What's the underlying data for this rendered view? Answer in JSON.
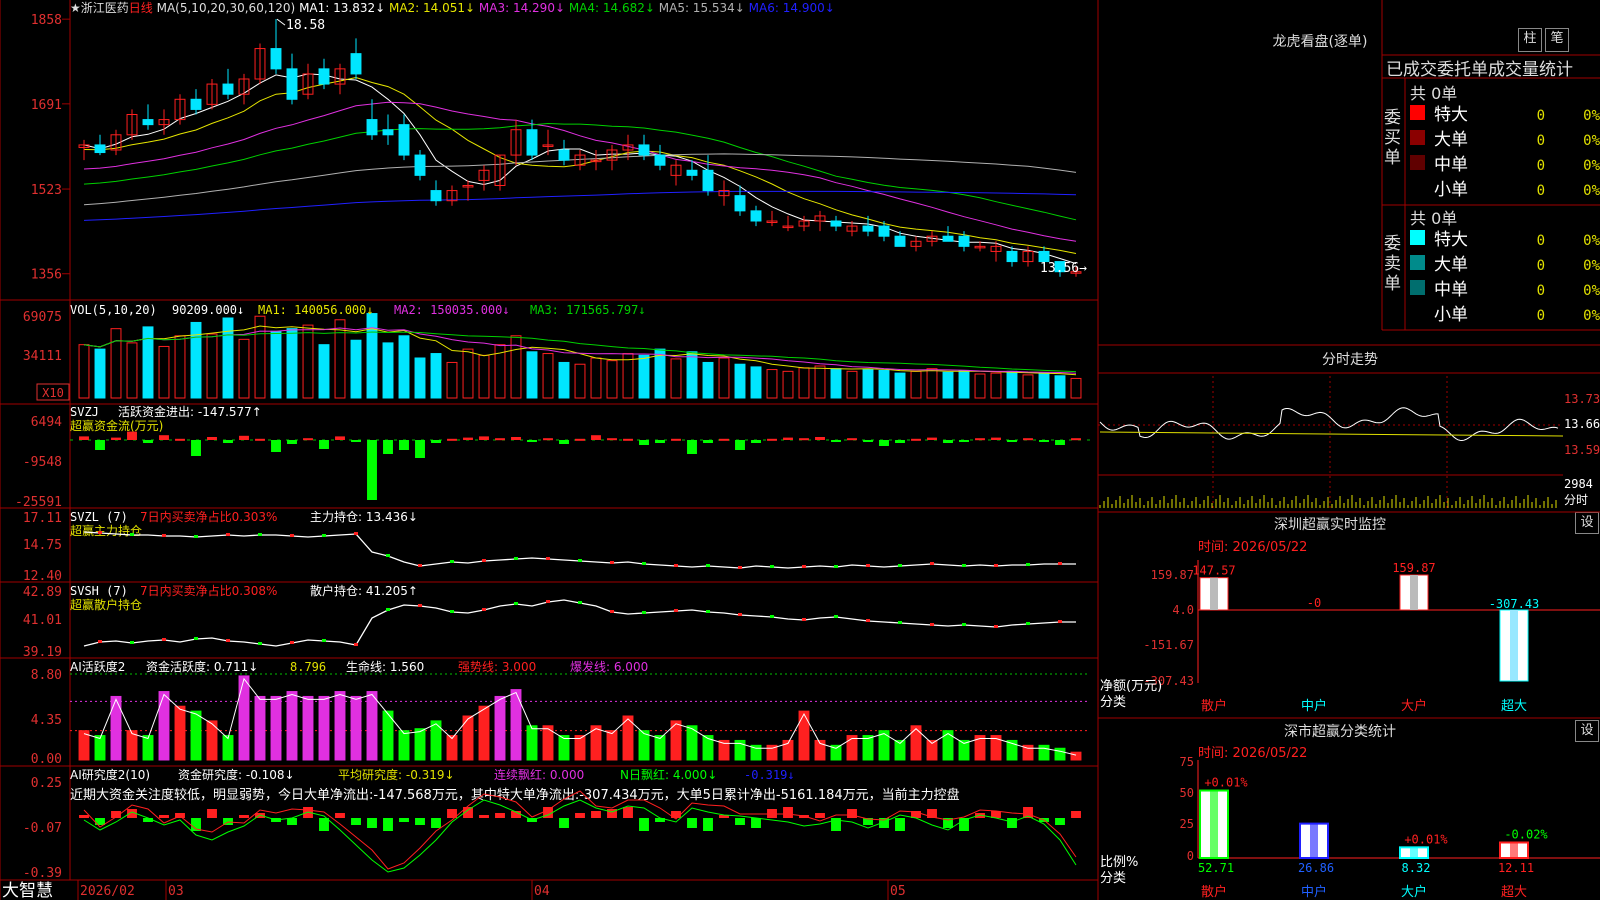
{
  "colors": {
    "up": "#ff2020",
    "down": "#00e6ff",
    "grid": "#a00000",
    "ma5": "#ffffff",
    "ma10": "#e5e500",
    "ma20": "#e030e0",
    "ma30": "#00d000",
    "ma60": "#b0b0b0",
    "ma120": "#2020ff",
    "white": "#ffffff",
    "yellow": "#e0e000",
    "magenta": "#e030e0",
    "green": "#00ff00",
    "axis": "#e03030"
  },
  "main": {
    "stock_name": "★浙江医药",
    "period": "日线",
    "ma_title": "MA(5,10,20,30,60,120)",
    "ma_values": [
      {
        "label": "MA1: 13.832↓",
        "color": "#ffffff"
      },
      {
        "label": "MA2: 14.051↓",
        "color": "#e5e500"
      },
      {
        "label": "MA3: 14.290↓",
        "color": "#e030e0"
      },
      {
        "label": "MA4: 14.682↓",
        "color": "#00d000"
      },
      {
        "label": "MA5: 15.534↓",
        "color": "#b0b0b0"
      },
      {
        "label": "MA6: 14.900↓",
        "color": "#2020ff"
      }
    ],
    "y_ticks": [
      "1858",
      "1691",
      "1523",
      "1356"
    ],
    "high_label": "18.58",
    "low_label": "13.56→"
  },
  "vol": {
    "title": "VOL(5,10,20)",
    "value": "90209.000↓",
    "ma_values": [
      {
        "label": "MA1: 140056.000↓",
        "color": "#e5e500"
      },
      {
        "label": "MA2: 150035.000↓",
        "color": "#e030e0"
      },
      {
        "label": "MA3: 171565.797↓",
        "color": "#00d000"
      }
    ],
    "y_ticks": [
      "69075",
      "34111"
    ],
    "unit": "X10"
  },
  "svzj": {
    "title": "SVZJ",
    "label": "活跃资金进出: -147.577↑",
    "subtitle": "超赢资金流(万元)",
    "y_ticks": [
      "6494",
      "-9548",
      "-25591"
    ]
  },
  "svzl": {
    "title": "SVZL (7)",
    "ratio_text": "7日内买卖净占比0.303%",
    "hold_text": "主力持仓: 13.436↓",
    "subtitle": "超赢主力持仓",
    "y_ticks": [
      "17.11",
      "14.75",
      "12.40"
    ]
  },
  "svsh": {
    "title": "SVSH (7)",
    "ratio_text": "7日内买卖净占比0.308%",
    "hold_text": "散户持仓: 41.205↑",
    "subtitle": "超赢散户持仓",
    "y_ticks": [
      "42.89",
      "41.01",
      "39.19"
    ]
  },
  "ai_active": {
    "title": "AI活跃度2",
    "v1": "资金活跃度: 0.711↓",
    "v2": "8.796",
    "v3": "生命线: 1.560",
    "v4": "强势线: 3.000",
    "v5": "爆发线: 6.000",
    "y_ticks": [
      "8.80",
      "4.35",
      "0.00"
    ]
  },
  "ai_research": {
    "title": "AI研究度2(10)",
    "v1": "资金研究度: -0.108↓",
    "v2": "平均研究度: -0.319↓",
    "v3": "连续飘红: 0.000",
    "v4": "N日飘红: 4.000↓",
    "v5": "-0.319↓",
    "comment": "近期大资金关注度较低，明显弱势，今日大单净流出:-147.568万元，其中特大单净流出:-307.434万元，大单5日累计净出-5161.184万元，当前主力控盘",
    "y_ticks": [
      "0.25",
      "-0.07",
      "-0.39"
    ]
  },
  "bottom_bar": {
    "brand": "大智慧",
    "dates": [
      "2026/02",
      "03",
      "04",
      "05"
    ]
  },
  "right": {
    "dragon_title": "龙虎看盘(逐单)",
    "btn1": "柱",
    "btn2": "笔",
    "stat_title": "已成交委托单成交量统计",
    "buy_label": "委买单",
    "sell_label": "委卖单",
    "buy_total": "共 0单",
    "sell_total": "共 0单",
    "buy_rows": [
      {
        "name": "特大",
        "count": "0",
        "pct": "0%",
        "color": "#ff0000"
      },
      {
        "name": "大单",
        "count": "0",
        "pct": "0%",
        "color": "#8b0000"
      },
      {
        "name": "中单",
        "count": "0",
        "pct": "0%",
        "color": "#600000"
      },
      {
        "name": "小单",
        "count": "0",
        "pct": "0%",
        "color": ""
      }
    ],
    "sell_rows": [
      {
        "name": "特大",
        "count": "0",
        "pct": "0%",
        "color": "#00ffff"
      },
      {
        "name": "大单",
        "count": "0",
        "pct": "0%",
        "color": "#008b8b"
      },
      {
        "name": "中单",
        "count": "0",
        "pct": "0%",
        "color": "#006e6e"
      },
      {
        "name": "小单",
        "count": "0",
        "pct": "0%",
        "color": ""
      }
    ],
    "intraday_title": "分时走势",
    "intraday_ticks": [
      "13.73",
      "13.66",
      "13.59"
    ],
    "intraday_vol": "2984",
    "intraday_unit": "分时",
    "monitor_title": "深圳超赢实时监控",
    "monitor_btn": "设",
    "monitor_time": "时间: 2026/05/22",
    "monitor_ticks": [
      "159.87",
      "4.0",
      "-151.67",
      "-307.43"
    ],
    "monitor_ylabel": "净额(万元)",
    "monitor_xlabel": "分类",
    "classify_title": "深市超赢分类统计",
    "classify_btn": "设",
    "classify_time": "时间: 2026/05/22",
    "classify_ticks": [
      "75",
      "50",
      "25",
      "0"
    ],
    "classify_ylabel": "比例%",
    "classify_xlabel": "分类"
  },
  "chart_data": [
    {
      "type": "candlestick",
      "title": "★浙江医药 日线",
      "ylim": [
        13.2,
        18.8
      ],
      "ohlc": [
        [
          16.05,
          16.2,
          15.8,
          16.1
        ],
        [
          16.1,
          16.3,
          15.9,
          15.95
        ],
        [
          16.0,
          16.4,
          15.9,
          16.3
        ],
        [
          16.3,
          16.8,
          16.2,
          16.7
        ],
        [
          16.6,
          16.9,
          16.4,
          16.5
        ],
        [
          16.5,
          16.8,
          16.3,
          16.6
        ],
        [
          16.6,
          17.1,
          16.5,
          17.0
        ],
        [
          17.0,
          17.2,
          16.7,
          16.8
        ],
        [
          16.9,
          17.4,
          16.8,
          17.3
        ],
        [
          17.3,
          17.6,
          17.0,
          17.1
        ],
        [
          17.1,
          17.5,
          16.9,
          17.4
        ],
        [
          17.4,
          18.1,
          17.3,
          18.0
        ],
        [
          18.0,
          18.58,
          17.5,
          17.6
        ],
        [
          17.6,
          17.9,
          16.9,
          17.0
        ],
        [
          17.1,
          17.7,
          17.0,
          17.5
        ],
        [
          17.6,
          17.8,
          17.2,
          17.3
        ],
        [
          17.3,
          17.7,
          17.1,
          17.6
        ],
        [
          17.9,
          18.2,
          17.4,
          17.5
        ],
        [
          16.6,
          17.0,
          16.2,
          16.3
        ],
        [
          16.4,
          16.7,
          16.1,
          16.3
        ],
        [
          16.5,
          16.7,
          15.8,
          15.9
        ],
        [
          15.9,
          16.0,
          15.4,
          15.5
        ],
        [
          15.2,
          15.4,
          14.9,
          15.0
        ],
        [
          15.0,
          15.3,
          14.9,
          15.2
        ],
        [
          15.3,
          15.4,
          15.0,
          15.3
        ],
        [
          15.4,
          15.7,
          15.2,
          15.6
        ],
        [
          15.3,
          15.9,
          15.2,
          15.9
        ],
        [
          15.9,
          16.6,
          15.7,
          16.4
        ],
        [
          16.4,
          16.6,
          15.8,
          15.9
        ],
        [
          16.1,
          16.4,
          15.9,
          16.1
        ],
        [
          16.0,
          16.2,
          15.7,
          15.8
        ],
        [
          15.7,
          16.0,
          15.6,
          15.9
        ],
        [
          15.8,
          16.0,
          15.6,
          15.8
        ],
        [
          15.8,
          16.1,
          15.6,
          16.0
        ],
        [
          16.0,
          16.3,
          15.8,
          16.1
        ],
        [
          16.1,
          16.3,
          15.8,
          15.9
        ],
        [
          15.9,
          16.1,
          15.6,
          15.7
        ],
        [
          15.5,
          15.8,
          15.3,
          15.7
        ],
        [
          15.6,
          15.8,
          15.4,
          15.5
        ],
        [
          15.6,
          15.9,
          15.1,
          15.2
        ],
        [
          15.1,
          15.4,
          14.9,
          15.2
        ],
        [
          15.1,
          15.3,
          14.7,
          14.8
        ],
        [
          14.8,
          14.9,
          14.5,
          14.6
        ],
        [
          14.6,
          14.8,
          14.5,
          14.6
        ],
        [
          14.5,
          14.7,
          14.4,
          14.5
        ],
        [
          14.5,
          14.7,
          14.4,
          14.6
        ],
        [
          14.6,
          14.8,
          14.4,
          14.7
        ],
        [
          14.6,
          14.7,
          14.4,
          14.5
        ],
        [
          14.4,
          14.6,
          14.3,
          14.5
        ],
        [
          14.5,
          14.7,
          14.3,
          14.4
        ],
        [
          14.5,
          14.6,
          14.2,
          14.3
        ],
        [
          14.3,
          14.4,
          14.1,
          14.1
        ],
        [
          14.1,
          14.3,
          14.0,
          14.2
        ],
        [
          14.2,
          14.4,
          14.1,
          14.3
        ],
        [
          14.3,
          14.5,
          14.2,
          14.2
        ],
        [
          14.3,
          14.4,
          14.0,
          14.1
        ],
        [
          14.1,
          14.2,
          14.0,
          14.1
        ],
        [
          14.0,
          14.2,
          13.8,
          14.1
        ],
        [
          14.0,
          14.1,
          13.7,
          13.8
        ],
        [
          13.8,
          14.1,
          13.7,
          14.0
        ],
        [
          14.0,
          14.1,
          13.7,
          13.8
        ],
        [
          13.8,
          13.8,
          13.5,
          13.6
        ],
        [
          13.6,
          13.7,
          13.5,
          13.6
        ]
      ]
    }
  ]
}
